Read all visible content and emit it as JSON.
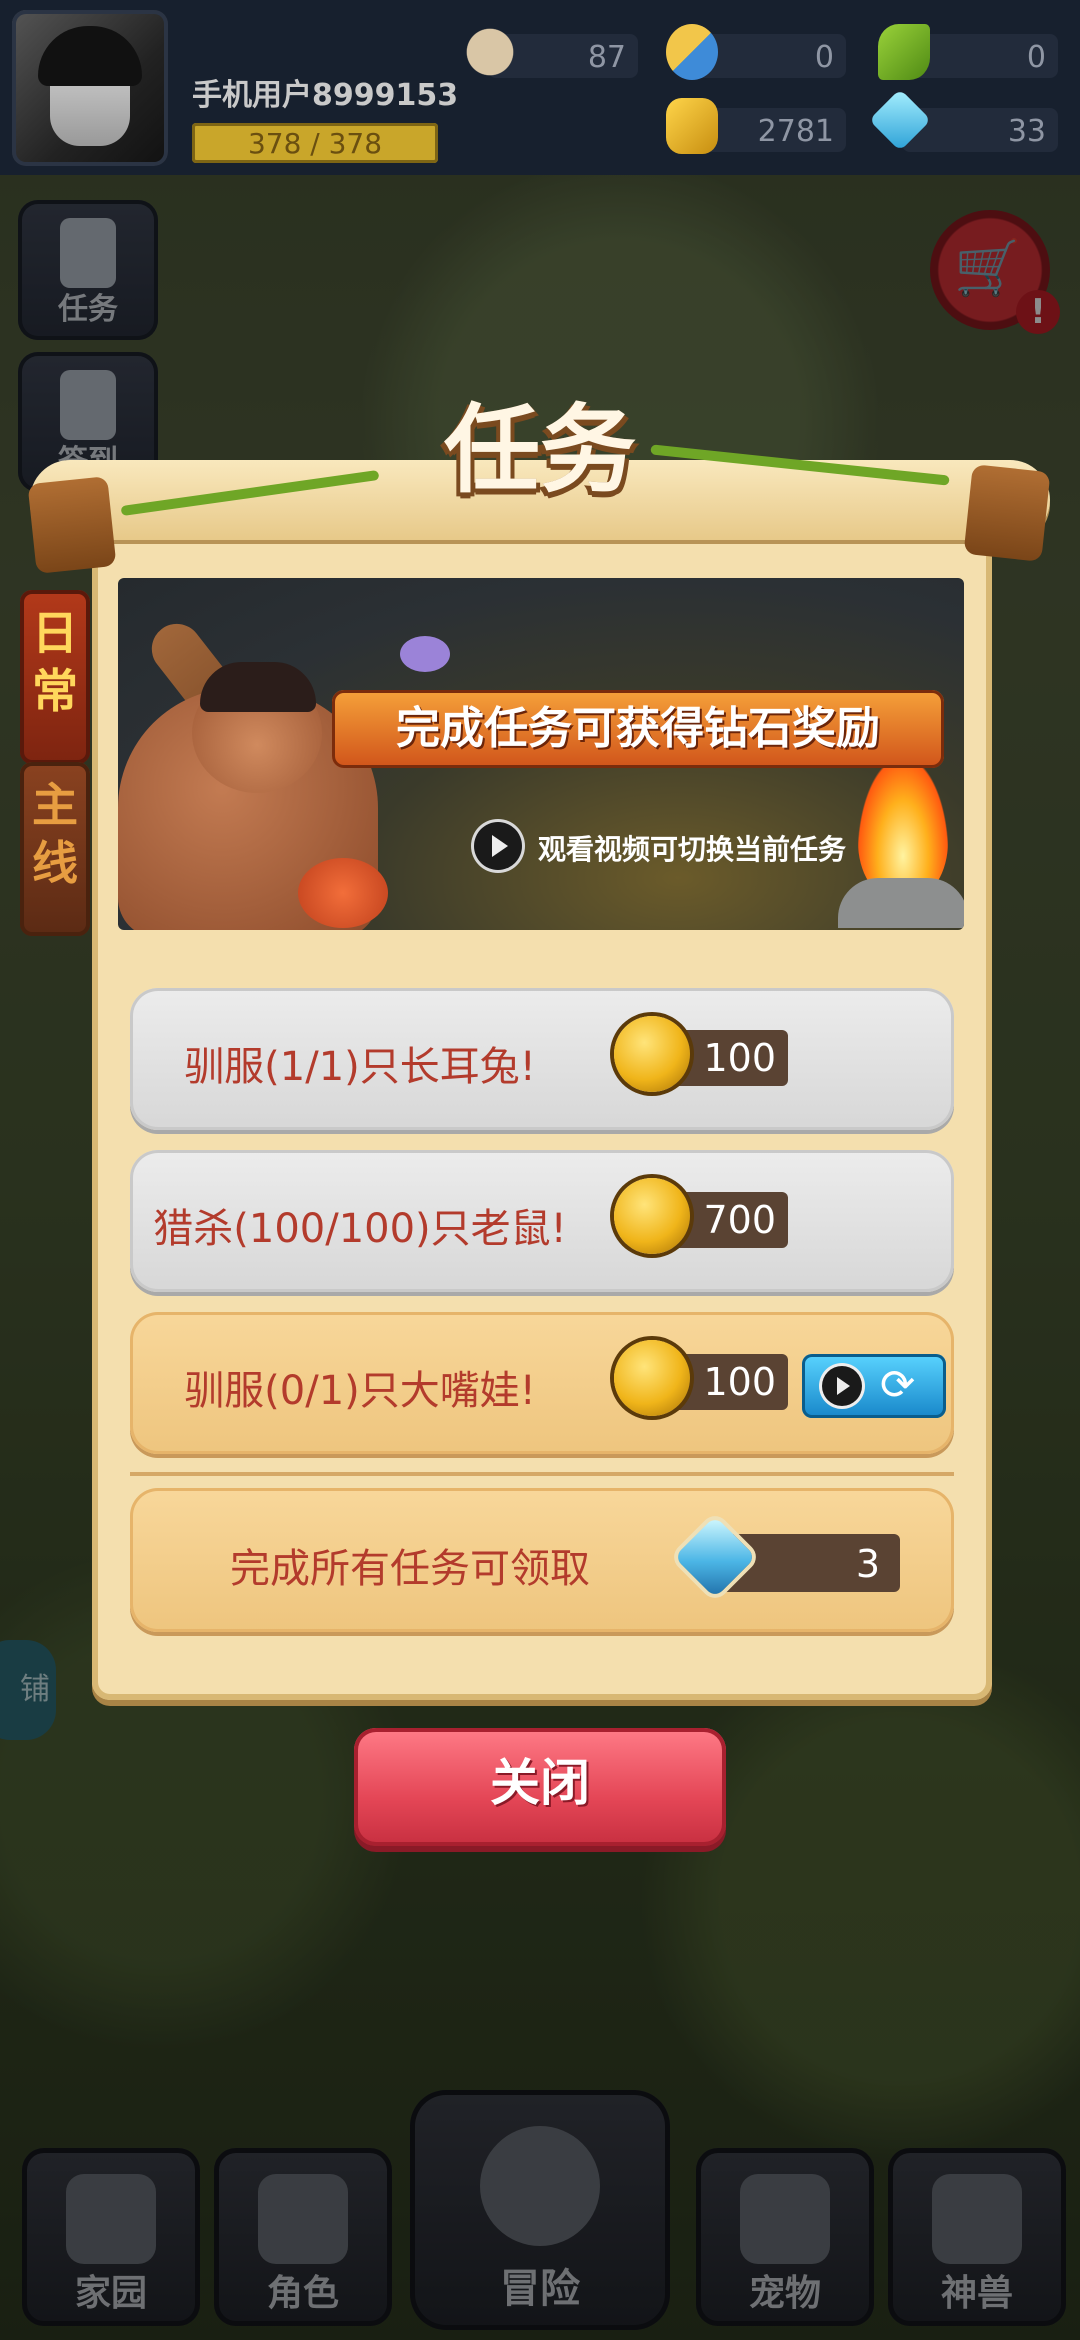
{
  "player": {
    "name": "手机用户8999153",
    "xp_text": "378 / 378"
  },
  "resources": {
    "bone": "87",
    "blue_item": "0",
    "green_item": "0",
    "gold": "2781",
    "gem": "33"
  },
  "side_buttons": {
    "task_label": "任务",
    "signin_label": "签到"
  },
  "tabs": {
    "daily": "日常",
    "main": "主线"
  },
  "dialog": {
    "title": "任务",
    "banner_headline": "完成任务可获得钻石奖励",
    "banner_video_text": "观看视频可切换当前任务",
    "tasks": [
      {
        "text": "驯服(1/1)只长耳兔!",
        "reward": "100",
        "status": "done"
      },
      {
        "text": "猎杀(100/100)只老鼠!",
        "reward": "700",
        "status": "done"
      },
      {
        "text": "驯服(0/1)只大嘴娃!",
        "reward": "100",
        "status": "todo"
      }
    ],
    "final_reward_text": "完成所有任务可领取",
    "final_reward_value": "3",
    "close_label": "关闭"
  },
  "side_shop_label": "铺",
  "bottom_nav": {
    "home": "家园",
    "role": "角色",
    "adventure": "冒险",
    "pet": "宠物",
    "beast": "神兽"
  },
  "colors": {
    "panel": "#f4dfae",
    "task_text": "#b33b2c",
    "close_button": "#e44656",
    "active_tab": "#b3391a"
  }
}
